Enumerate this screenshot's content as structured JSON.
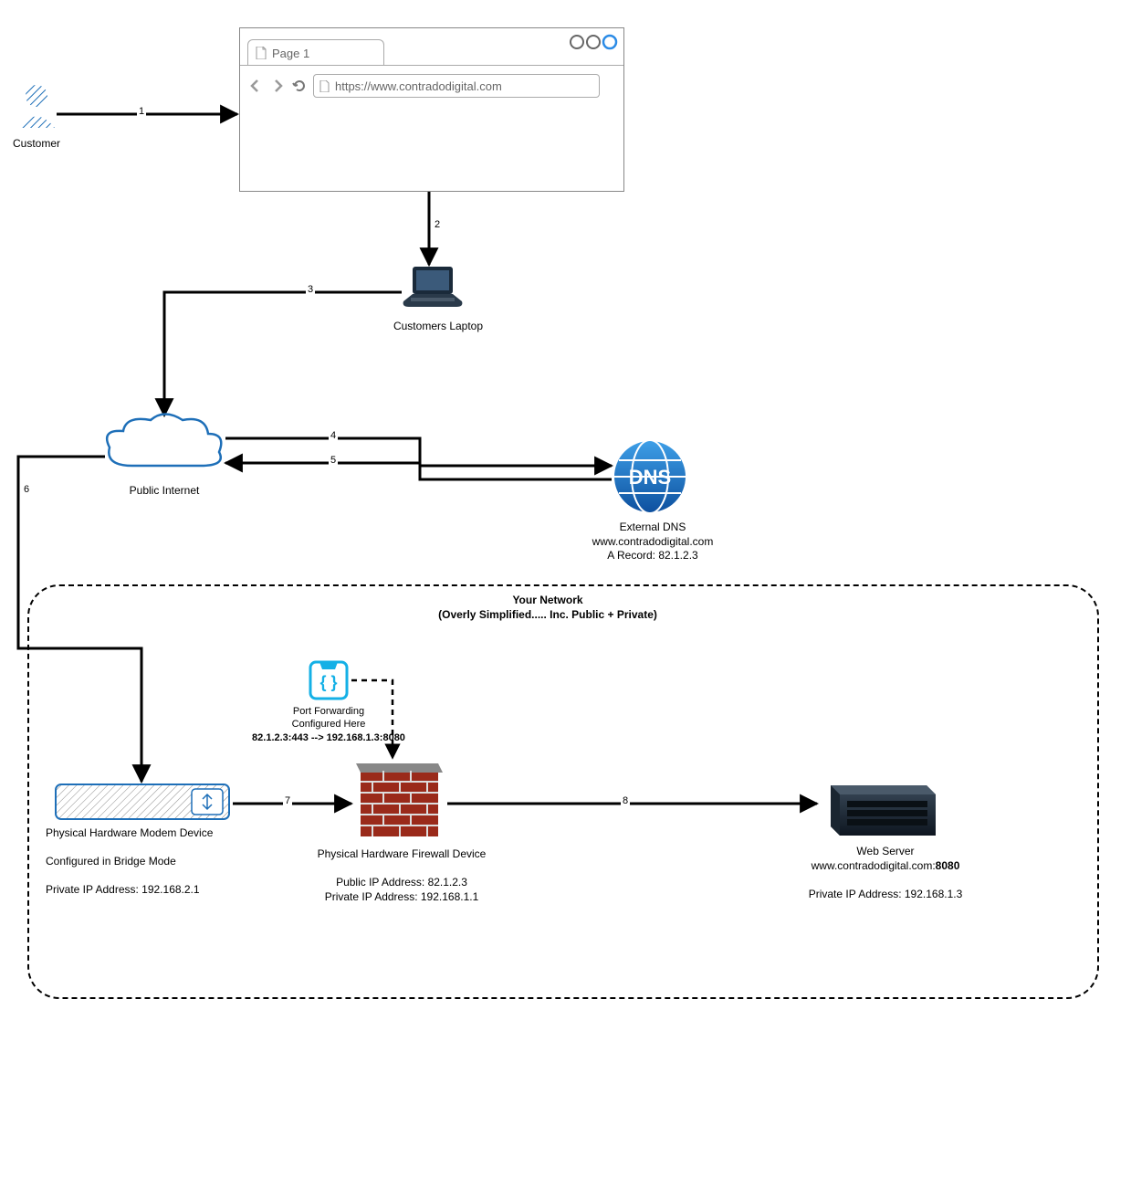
{
  "customer": {
    "label": "Customer"
  },
  "browser": {
    "tab_label": "Page 1",
    "url": "https://www.contradodigital.com"
  },
  "laptop": {
    "label": "Customers Laptop"
  },
  "cloud": {
    "label": "Public Internet"
  },
  "dns": {
    "label": "External DNS",
    "line2": "www.contradodigital.com",
    "line3": "A Record: 82.1.2.3"
  },
  "network_box": {
    "title": "Your Network",
    "subtitle": "(Overly Simplified..... Inc. Public + Private)"
  },
  "port_forwarding": {
    "line1": "Port Forwarding",
    "line2": "Configured Here",
    "rule": "82.1.2.3:443 --> 192.168.1.3:8080"
  },
  "modem": {
    "label": "Physical Hardware Modem Device",
    "line2": "Configured in Bridge Mode",
    "line3": "Private IP Address: 192.168.2.1"
  },
  "firewall": {
    "label": "Physical Hardware Firewall Device",
    "line2": "Public IP Address: 82.1.2.3",
    "line3": "Private IP Address: 192.168.1.1"
  },
  "webserver": {
    "label": "Web Server",
    "line2": "www.contradodigital.com:8080",
    "line3": "Private IP Address: 192.168.1.3"
  },
  "edges": {
    "e1": "1",
    "e2": "2",
    "e3": "3",
    "e4": "4",
    "e5": "5",
    "e6": "6",
    "e7": "7",
    "e8": "8"
  }
}
